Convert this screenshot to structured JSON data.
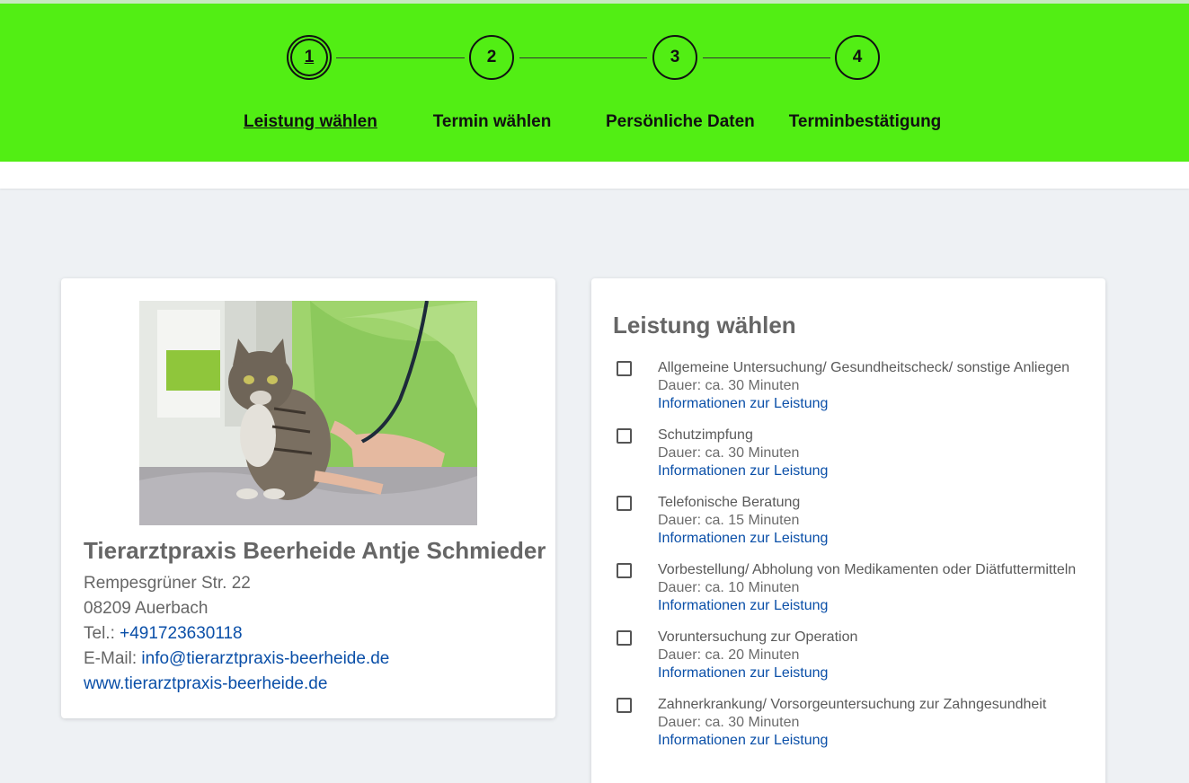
{
  "steps": [
    {
      "number": "1",
      "label": "Leistung wählen",
      "active": true
    },
    {
      "number": "2",
      "label": "Termin wählen",
      "active": false
    },
    {
      "number": "3",
      "label": "Persönliche Daten",
      "active": false
    },
    {
      "number": "4",
      "label": "Terminbestätigung",
      "active": false
    }
  ],
  "practice": {
    "name": "Tierarztpraxis Beerheide Antje Schmieder",
    "street": "Rempesgrüner Str. 22",
    "city": "08209 Auerbach",
    "phone_label": "Tel.:",
    "phone": "+491723630118",
    "email_label": "E-Mail:",
    "email": "info@tierarztpraxis-beerheide.de",
    "website": "www.tierarztpraxis-beerheide.de"
  },
  "services_section": {
    "title": "Leistung wählen",
    "info_label": "Informationen zur Leistung",
    "items": [
      {
        "title": "Allgemeine Untersuchung/ Gesundheitscheck/ sonstige Anliegen",
        "duration": "Dauer: ca. 30 Minuten",
        "checked": false
      },
      {
        "title": "Schutzimpfung",
        "duration": "Dauer: ca. 30 Minuten",
        "checked": false
      },
      {
        "title": "Telefonische Beratung",
        "duration": "Dauer: ca. 15 Minuten",
        "checked": false
      },
      {
        "title": "Vorbestellung/ Abholung von Medikamenten oder Diätfuttermitteln",
        "duration": "Dauer: ca. 10 Minuten",
        "checked": false
      },
      {
        "title": "Voruntersuchung zur Operation",
        "duration": "Dauer: ca. 20 Minuten",
        "checked": false
      },
      {
        "title": "Zahnerkrankung/ Vorsorgeuntersuchung zur Zahngesundheit",
        "duration": "Dauer: ca. 30 Minuten",
        "checked": false
      }
    ]
  },
  "colors": {
    "stepper_bg": "#52ee14",
    "link": "#0a4fa8",
    "page_bg": "#eef1f4"
  }
}
